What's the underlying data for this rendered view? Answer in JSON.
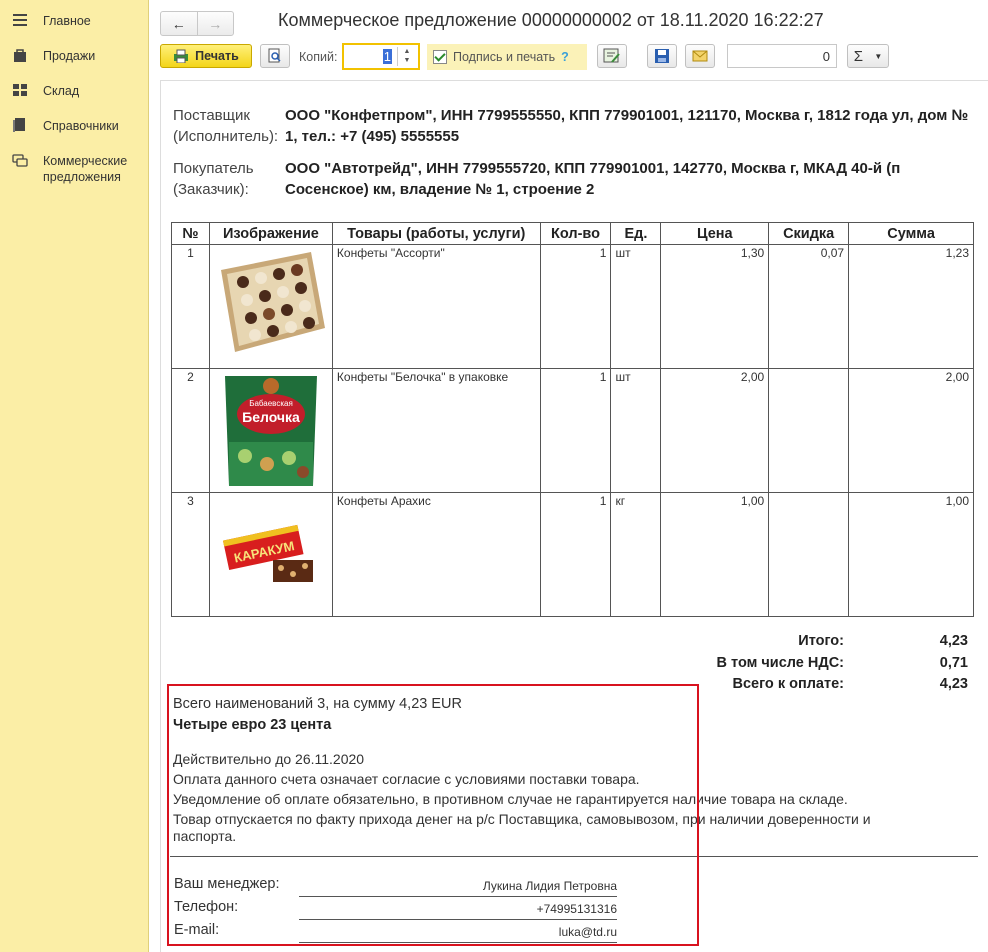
{
  "sidebar": {
    "items": [
      {
        "label": "Главное",
        "icon": "menu-icon"
      },
      {
        "label": "Продажи",
        "icon": "bag-icon"
      },
      {
        "label": "Склад",
        "icon": "grid-icon"
      },
      {
        "label": "Справочники",
        "icon": "book-icon"
      },
      {
        "label": "Коммерческие предложения",
        "icon": "chat-icon"
      }
    ]
  },
  "header": {
    "title": "Коммерческое предложение 00000000002 от 18.11.2020 16:22:27"
  },
  "toolbar": {
    "print_label": "Печать",
    "copies_label": "Копий:",
    "copies_value": "1",
    "sign_print_label": "Подпись и печать",
    "help_label": "?",
    "sum_value": "0",
    "sigma_label": "Σ"
  },
  "document": {
    "supplier_label_1": "Поставщик",
    "supplier_label_2": "(Исполнитель):",
    "supplier_value": "ООО \"Конфетпром\", ИНН 7799555550, КПП 779901001, 121170, Москва г, 1812 года ул, дом № 1, тел.: +7 (495) 5555555",
    "buyer_label_1": "Покупатель",
    "buyer_label_2": "(Заказчик):",
    "buyer_value": "ООО \"Автотрейд\", ИНН 7799555720, КПП 779901001, 142770, Москва г, МКАД 40-й (п Сосенское) км, владение № 1, строение 2",
    "columns": [
      "№",
      "Изображение",
      "Товары (работы, услуги)",
      "Кол-во",
      "Ед.",
      "Цена",
      "Скидка",
      "Сумма"
    ],
    "rows": [
      {
        "n": "1",
        "name": "Конфеты \"Ассорти\"",
        "qty": "1",
        "unit": "шт",
        "price": "1,30",
        "discount": "0,07",
        "sum": "1,23"
      },
      {
        "n": "2",
        "name": "Конфеты \"Белочка\" в упаковке",
        "qty": "1",
        "unit": "шт",
        "price": "2,00",
        "discount": "",
        "sum": "2,00"
      },
      {
        "n": "3",
        "name": "Конфеты Арахис",
        "qty": "1",
        "unit": "кг",
        "price": "1,00",
        "discount": "",
        "sum": "1,00"
      }
    ],
    "totals": {
      "total_label": "Итого:",
      "total_value": "4,23",
      "vat_label": "В том числе НДС:",
      "vat_value": "0,71",
      "due_label": "Всего к оплате:",
      "due_value": "4,23"
    },
    "packs": {
      "belochka_brand": "Белочка",
      "belochka_small": "Бабаевская",
      "karakum_label": "КАРАКУМ"
    },
    "notes": {
      "count_sum": "Всего наименований 3, на сумму 4,23 EUR",
      "in_words": "Четыре евро 23 цента",
      "valid_until": "Действительно до 26.11.2020",
      "line1": "Оплата данного счета означает согласие с условиями поставки товара.",
      "line2": "Уведомление об оплате обязательно, в противном случае не гарантируется наличие товара на складе.",
      "line3a": "Товар отпускается по факту прихода денег на р/с Поставщика, самовывозом, при наличии доверенности и",
      "line3b": "паспорта."
    },
    "signature": {
      "manager_label": "Ваш менеджер:",
      "manager_value": "Лукина Лидия Петровна",
      "phone_label": "Телефон:",
      "phone_value": "+74995131316",
      "email_label": "E-mail:",
      "email_value": "luka@td.ru"
    }
  },
  "colors": {
    "sidebar_bg": "#fbeea6",
    "print_button": "#f3d51a",
    "highlight_box": "#d8131f"
  }
}
